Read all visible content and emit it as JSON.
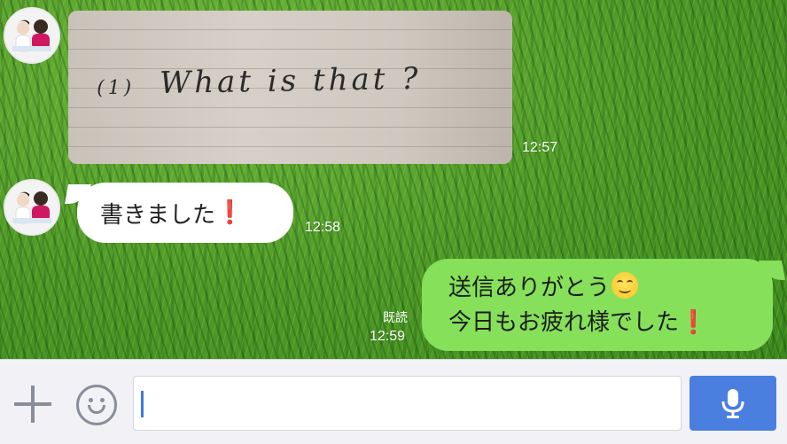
{
  "messages": [
    {
      "side": "left",
      "type": "image",
      "handwriting": {
        "number": "(1)",
        "text": "What is that ?"
      },
      "time": "12:57"
    },
    {
      "side": "left",
      "type": "text",
      "text": "書きました",
      "emoji": "❗",
      "time": "12:58"
    },
    {
      "side": "right",
      "type": "text",
      "line1": "送信ありがとう",
      "line1_emoji": "smiling-face",
      "line2": "今日もお疲れ様でした",
      "line2_emoji": "❗",
      "read_label": "既読",
      "time": "12:59"
    }
  ],
  "input": {
    "placeholder": "",
    "value": ""
  },
  "colors": {
    "outgoing_bubble": "#86e05a",
    "incoming_bubble": "#ffffff",
    "send_button": "#4a7fe0",
    "background": "#4f9a28"
  },
  "icons": {
    "add": "plus-icon",
    "emoji": "smiley-icon",
    "voice": "microphone-icon"
  }
}
